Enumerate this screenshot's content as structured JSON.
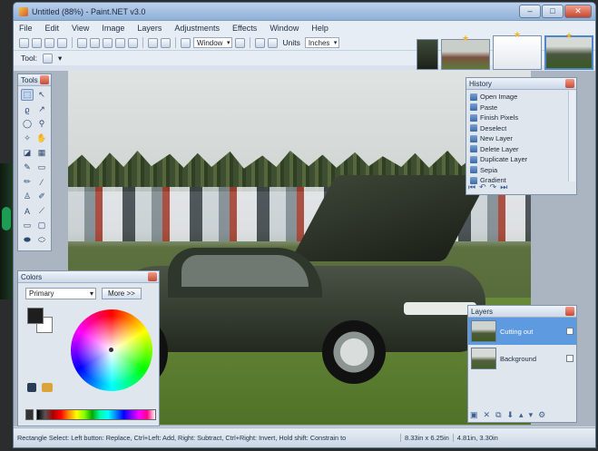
{
  "window": {
    "title": "Untitled (88%) - Paint.NET v3.0"
  },
  "menu": [
    "File",
    "Edit",
    "View",
    "Image",
    "Layers",
    "Adjustments",
    "Effects",
    "Window",
    "Help"
  ],
  "toolbar": {
    "window_label": "Window",
    "zoom_dropdown": "Window",
    "units_label": "Units",
    "units_value": "Inches",
    "tool_label": "Tool:"
  },
  "tools_panel": {
    "title": "Tools"
  },
  "history": {
    "title": "History",
    "items": [
      "Open Image",
      "Paste",
      "Finish Pixels",
      "Deselect",
      "New Layer",
      "Delete Layer",
      "Duplicate Layer",
      "Sepia",
      "Gradient"
    ]
  },
  "colors": {
    "title": "Colors",
    "mode_value": "Primary",
    "more_button": "More >>",
    "primary_color": "#1e1e1e",
    "secondary_color": "#ffffff"
  },
  "layers": {
    "title": "Layers",
    "items": [
      {
        "name": "Cutting out",
        "selected": true
      },
      {
        "name": "Background",
        "selected": false
      }
    ]
  },
  "status": {
    "hint": "Rectangle Select: Left button: Replace, Ctrl+Left: Add, Right: Subtract, Ctrl+Right: Invert, Hold shift: Constrain to",
    "size": "8.33in x 6.25in",
    "position": "4.81in, 3.30in"
  }
}
